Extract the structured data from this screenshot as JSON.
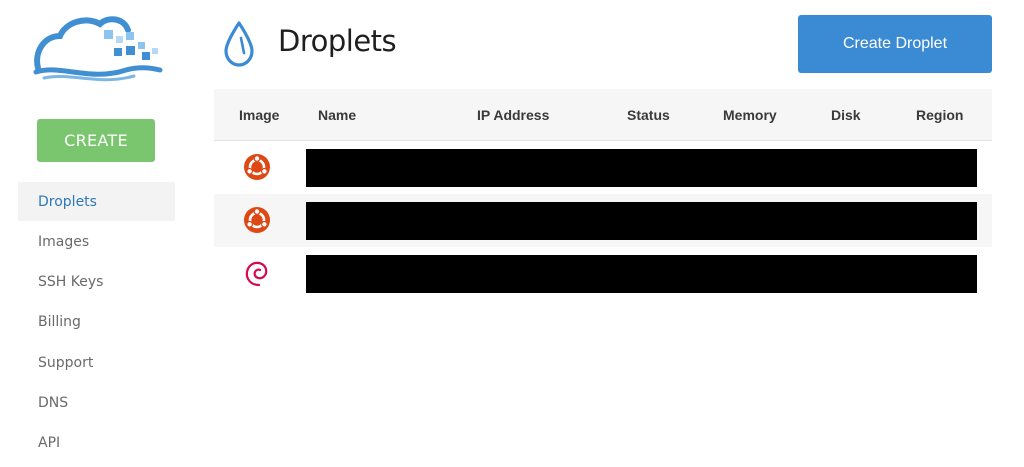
{
  "sidebar": {
    "create_label": "CREATE",
    "nav": [
      "Droplets",
      "Images",
      "SSH Keys",
      "Billing",
      "Support",
      "DNS",
      "API"
    ],
    "active_index": 0
  },
  "header": {
    "title": "Droplets",
    "create_button": "Create Droplet"
  },
  "table": {
    "columns": [
      "Image",
      "Name",
      "IP Address",
      "Status",
      "Memory",
      "Disk",
      "Region"
    ],
    "rows": [
      {
        "image": "ubuntu-icon"
      },
      {
        "image": "ubuntu-icon"
      },
      {
        "image": "debian-icon"
      }
    ]
  },
  "colors": {
    "create_green": "#79c66e",
    "primary_blue": "#3a8bd4",
    "active_nav_text": "#2f78b7",
    "ubuntu_orange": "#dd4814",
    "debian_red": "#d70751"
  }
}
